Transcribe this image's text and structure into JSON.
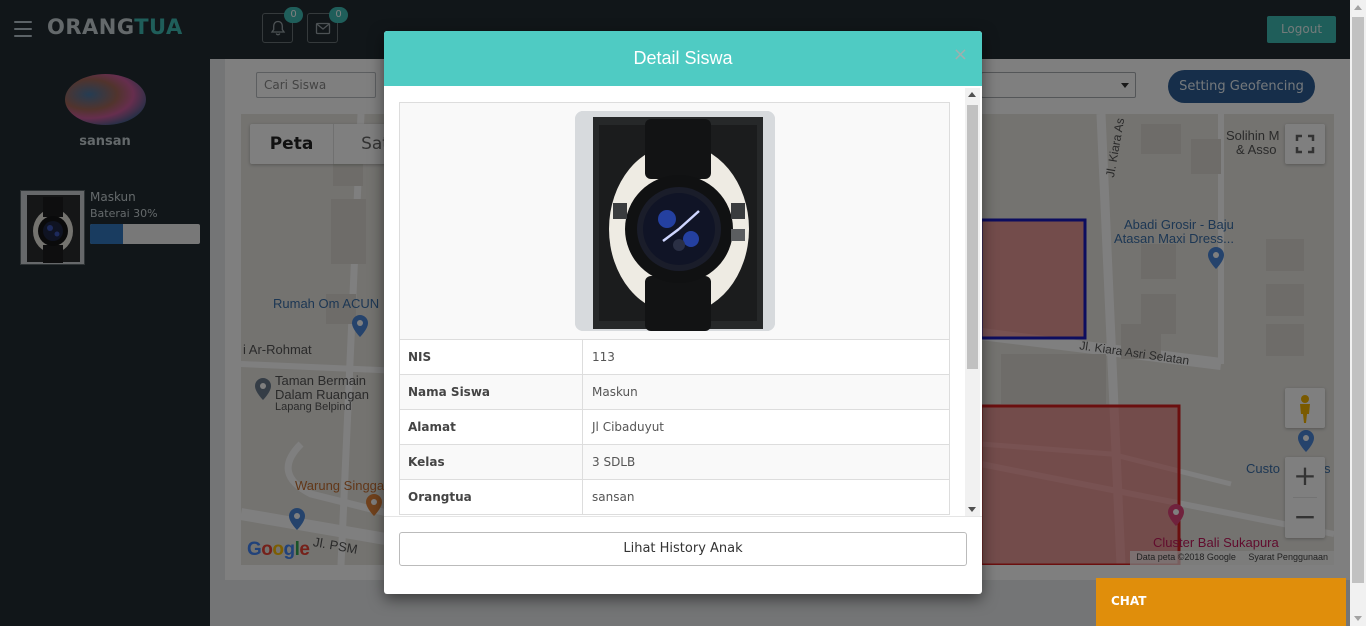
{
  "header": {
    "brand_part1": "ORANG",
    "brand_part2": "TUA",
    "notifications_count": "0",
    "messages_count": "0",
    "logout_label": "Logout"
  },
  "sidebar": {
    "user_name": "sansan",
    "child": {
      "name": "Maskun",
      "battery_label": "Baterai 30%",
      "battery_level": 0.3
    }
  },
  "toolbar": {
    "search_placeholder": "Cari Siswa",
    "geofence_button": "Setting Geofencing"
  },
  "map": {
    "tab_map": "Peta",
    "tab_satellite": "Sat",
    "labels": {
      "rumah": "Rumah Om ACUN",
      "rohmat": "i Ar-Rohmat",
      "taman1": "Taman Bermain",
      "taman2": "Dalam Ruangan",
      "lapang": "Lapang Belpind",
      "warung": "Warung Singga",
      "psm": "Jl. PSM",
      "kiara": "Jl. Kiara As",
      "kiara_selatan": "Jl. Kiara Asri Selatan",
      "solihin1": "Solihin M",
      "solihin2": "& Asso",
      "abadi1": "Abadi Grosir - Baju",
      "abadi2": "Atasan Maxi Dress...",
      "custom": "Custo",
      "custom_tail": "s",
      "cluster": "Cluster Bali Sukapura"
    },
    "google_logo": "Google",
    "attribution_data": "Data peta ©2018 Google",
    "attribution_terms": "Syarat Penggunaan",
    "zoom_in": "+",
    "zoom_out": "−"
  },
  "modal": {
    "title": "Detail Siswa",
    "close": "×",
    "details": [
      {
        "label": "NIS",
        "value": "113"
      },
      {
        "label": "Nama Siswa",
        "value": "Maskun"
      },
      {
        "label": "Alamat",
        "value": "Jl Cibaduyut"
      },
      {
        "label": "Kelas",
        "value": "3 SDLB"
      },
      {
        "label": "Orangtua",
        "value": "sansan"
      }
    ],
    "history_button": "Lihat History Anak"
  },
  "chat": {
    "label": "CHAT"
  },
  "colors": {
    "topbar": "#222d32",
    "accent_teal": "#3fbcb5",
    "modal_header": "#4fcbc3",
    "geofence_button": "#2c5d94",
    "chat_tab": "#e08e0b",
    "battery_fill": "#3378c1"
  }
}
